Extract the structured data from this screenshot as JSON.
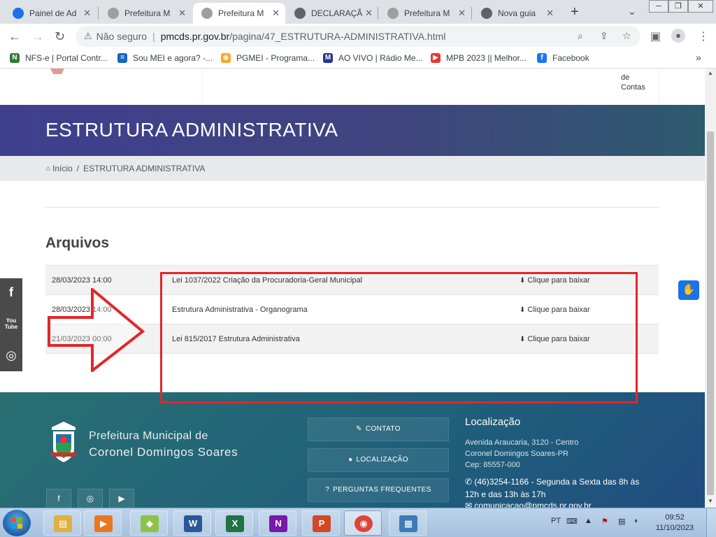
{
  "browser": {
    "tabs": [
      {
        "title": "Painel de Ad",
        "fav": "#1a73e8",
        "active": false
      },
      {
        "title": "Prefeitura M",
        "fav": "#9e9e9e",
        "active": false
      },
      {
        "title": "Prefeitura M",
        "fav": "#9e9e9e",
        "active": true
      },
      {
        "title": "DECLARAÇÃ",
        "fav": "#5f6368",
        "active": false
      },
      {
        "title": "Prefeitura M",
        "fav": "#9e9e9e",
        "active": false
      },
      {
        "title": "Nova guia",
        "fav": "#5f6368",
        "active": false
      }
    ],
    "close_glyph": "✕",
    "new_tab_glyph": "+",
    "tab_list_glyph": "⌄",
    "win_min": "─",
    "win_restore": "❐",
    "win_close": "✕",
    "omnibox": {
      "security_label": "Não seguro",
      "host": "pmcds.pr.gov.br",
      "path": "/pagina/47_ESTRUTURA-ADMINISTRATIVA.html"
    },
    "bookmarks": [
      {
        "label": "NFS-e | Portal Contr...",
        "icon": "N",
        "color": "#2e7d32"
      },
      {
        "label": "Sou MEI e agora? -...",
        "icon": "=",
        "color": "#1565c0"
      },
      {
        "label": "PGMEI - Programa...",
        "icon": "◉",
        "color": "#f9a825"
      },
      {
        "label": "AO VIVO | Rádio Me...",
        "icon": "M",
        "color": "#283593"
      },
      {
        "label": "MPB 2023 || Melhor...",
        "icon": "▶",
        "color": "#e53935"
      },
      {
        "label": "Facebook",
        "icon": "f",
        "color": "#1877f2"
      }
    ],
    "bookmarks_more": "»"
  },
  "site": {
    "nav_partial_label": "de\nContas",
    "page_title": "ESTRUTURA ADMINISTRATIVA",
    "breadcrumb": {
      "home": "Início",
      "separator": "/",
      "current": "ESTRUTURA ADMINISTRATIVA"
    },
    "section_title": "Arquivos",
    "files": [
      {
        "date": "28/03/2023 14:00",
        "name": "Lei 1037/2022 Criação da Procuradoria-Geral Municipal",
        "action": "Clique para baixar"
      },
      {
        "date": "28/03/2023 14:00",
        "name": "Estrutura Administrativa - Organograma",
        "action": "Clique para baixar"
      },
      {
        "date": "21/03/2023 00:00",
        "name": "Lei 815/2017 Estrutura Administrativa",
        "action": "Clique para baixar"
      }
    ],
    "side_social": [
      "f",
      "You\nTube",
      "◎"
    ],
    "footer": {
      "name_line1": "Prefeitura Municipal de",
      "name_line2": "Coronel Domingos Soares",
      "social": [
        "f",
        "◎",
        "▶"
      ],
      "buttons": [
        {
          "label": "CONTATO",
          "icon": "✎"
        },
        {
          "label": "LOCALIZAÇÃO",
          "icon": "●"
        },
        {
          "label": "PERGUNTAS FREQUENTES",
          "icon": "?"
        }
      ],
      "location_title": "Localização",
      "address": [
        "Avenida Araucaria, 3120 - Centro",
        "Coronel Domingos Soares-PR",
        "Cep: 85557-000"
      ],
      "phone": "(46)3254-1166 - Segunda a Sexta das 8h às 12h e das 13h às 17h",
      "email": "comunicacao@pmcds.pr.gov.br"
    }
  },
  "taskbar": {
    "lang": "PT",
    "time": "09:52",
    "date": "11/10/2023",
    "apps": [
      {
        "name": "explorer",
        "glyph": "▤",
        "color": "#e0b040"
      },
      {
        "name": "media-player",
        "glyph": "▶",
        "color": "#e87722"
      },
      {
        "name": "sticky",
        "glyph": "◆",
        "color": "#8bc34a"
      },
      {
        "name": "word",
        "glyph": "W",
        "color": "#2b579a"
      },
      {
        "name": "excel",
        "glyph": "X",
        "color": "#217346"
      },
      {
        "name": "onenote",
        "glyph": "N",
        "color": "#7719aa"
      },
      {
        "name": "powerpoint",
        "glyph": "P",
        "color": "#d24726"
      },
      {
        "name": "chrome",
        "glyph": "◉",
        "color": "#db4437"
      },
      {
        "name": "pictures",
        "glyph": "▦",
        "color": "#3d7ab8"
      }
    ]
  }
}
